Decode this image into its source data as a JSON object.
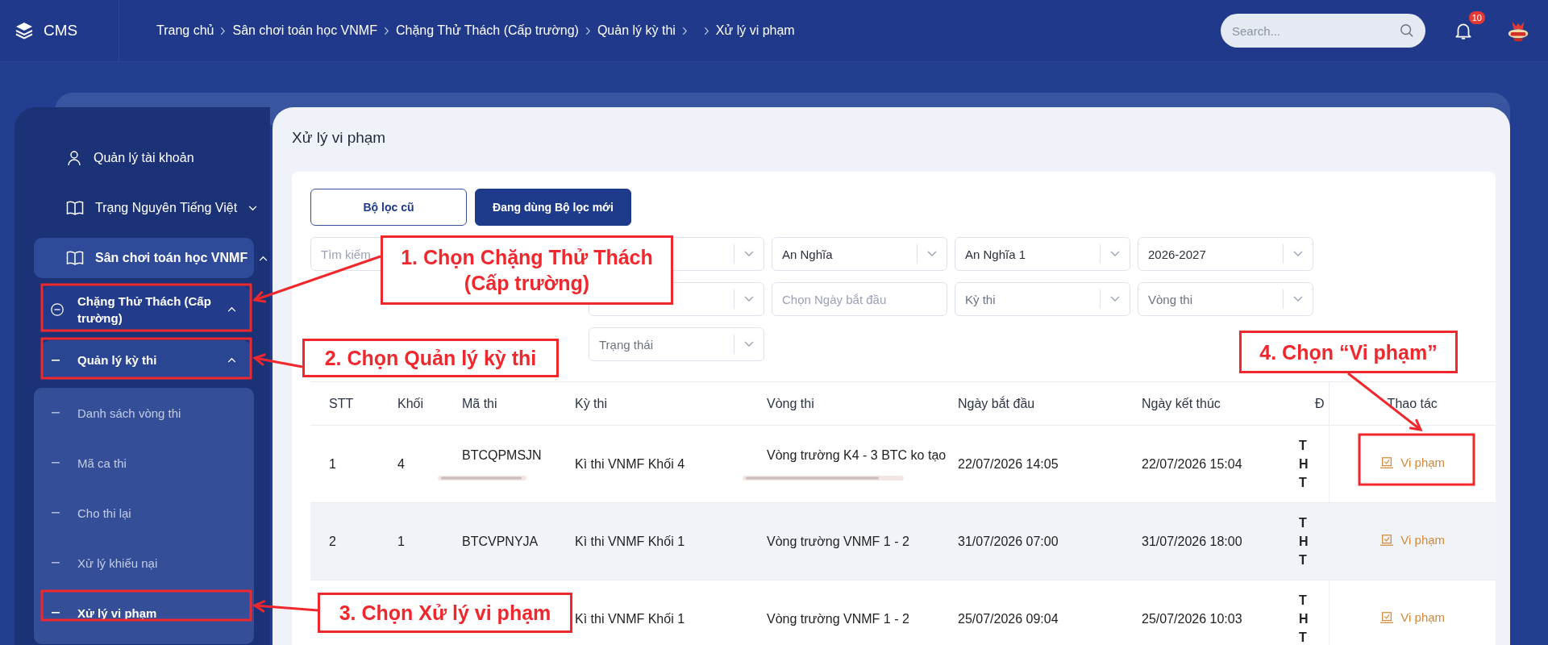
{
  "topbar": {
    "brand": "CMS",
    "search": {
      "placeholder": "Search..."
    },
    "notifications": {
      "count": "10"
    }
  },
  "breadcrumbs": [
    {
      "kind": "link",
      "label": "Trang chủ"
    },
    {
      "kind": "link",
      "label": "Sân chơi toán học VNMF"
    },
    {
      "kind": "link",
      "label": "Chặng Thử Thách (Cấp trường)"
    },
    {
      "kind": "link",
      "label": "Quản lý kỳ thi"
    },
    {
      "kind": "empty"
    },
    {
      "kind": "current",
      "label": "Xử lý vi phạm"
    }
  ],
  "sidebar": {
    "items": [
      {
        "kind": "link",
        "label": "Quản lý tài khoản"
      },
      {
        "kind": "group",
        "label": "Trạng Nguyên Tiếng Việt",
        "expanded": false
      },
      {
        "kind": "group",
        "label": "Sân chơi toán học VNMF",
        "expanded": true,
        "children": [
          {
            "label": "Chặng Thử Thách (Cấp trường)",
            "expanded": true,
            "children": [
              {
                "label": "Quản lý kỳ thi",
                "expanded": true,
                "children": [
                  {
                    "label": "Danh sách vòng thi",
                    "selected": false
                  },
                  {
                    "label": "Mã ca thi",
                    "selected": false
                  },
                  {
                    "label": "Cho thi lại",
                    "selected": false
                  },
                  {
                    "label": "Xử lý khiếu nại",
                    "selected": false
                  },
                  {
                    "label": "Xử lý vi phạm",
                    "selected": true
                  }
                ]
              }
            ]
          }
        ]
      }
    ]
  },
  "page": {
    "title": "Xử lý vi phạm"
  },
  "filter_modes": [
    {
      "label": "Bộ lọc cũ",
      "selected": false
    },
    {
      "label": "Đang dùng Bộ lọc mới",
      "selected": true
    }
  ],
  "filters": [
    {
      "kind": "search",
      "placeholder": "Tìm kiếm"
    },
    {
      "kind": "select"
    },
    {
      "kind": "select",
      "value": "An Nghĩa"
    },
    {
      "kind": "select",
      "value": "An Nghĩa 1"
    },
    {
      "kind": "select",
      "value": "2026-2027"
    },
    {
      "kind": "select"
    },
    {
      "kind": "date",
      "placeholder": "Chọn Ngày bắt đầu"
    },
    {
      "kind": "select",
      "placeholder": "Kỳ thi"
    },
    {
      "kind": "select",
      "placeholder": "Vòng thi"
    },
    {
      "kind": "select",
      "placeholder": "Trạng thái"
    }
  ],
  "table": {
    "columns": [
      "STT",
      "Khối",
      "Mã thi",
      "Kỳ thi",
      "Vòng thi",
      "Ngày bắt đầu",
      "Ngày kết thúc",
      "Đ",
      "Thao tác"
    ],
    "rows": [
      {
        "stt": "1",
        "khoi": "4",
        "ma_thi": "BTCQPMSJN",
        "ky_thi": "Kì thi VNMF Khối 4",
        "vong_thi": "Vòng trường K4 - 3 BTC ko tạo",
        "start": "22/07/2026 14:05",
        "end": "22/07/2026 15:04",
        "column_8": [
          "T",
          "H",
          "T"
        ],
        "action": "Vi phạm"
      },
      {
        "stt": "2",
        "khoi": "1",
        "ma_thi": "BTCVPNYJA",
        "ky_thi": "Kì thi VNMF Khối 1",
        "vong_thi": "Vòng trường VNMF 1 - 2",
        "start": "31/07/2026 07:00",
        "end": "31/07/2026 18:00",
        "column_8": [
          "T",
          "H",
          "T"
        ],
        "action": "Vi phạm"
      },
      {
        "ky_thi": "Kì thi VNMF Khối 1",
        "vong_thi": "Vòng trường VNMF 1 - 2",
        "start": "25/07/2026 09:04",
        "end": "25/07/2026 10:03",
        "column_8": [
          "T",
          "H",
          "T"
        ],
        "action": "Vi phạm"
      }
    ]
  },
  "annotations": [
    {
      "text": "1. Chọn Chặng Thử Thách (Cấp trường)"
    },
    {
      "text": "2. Chọn Quản lý kỳ thi"
    },
    {
      "text": "3. Chọn Xử lý vi phạm"
    },
    {
      "text": "4. Chọn “Vi phạm”"
    }
  ]
}
